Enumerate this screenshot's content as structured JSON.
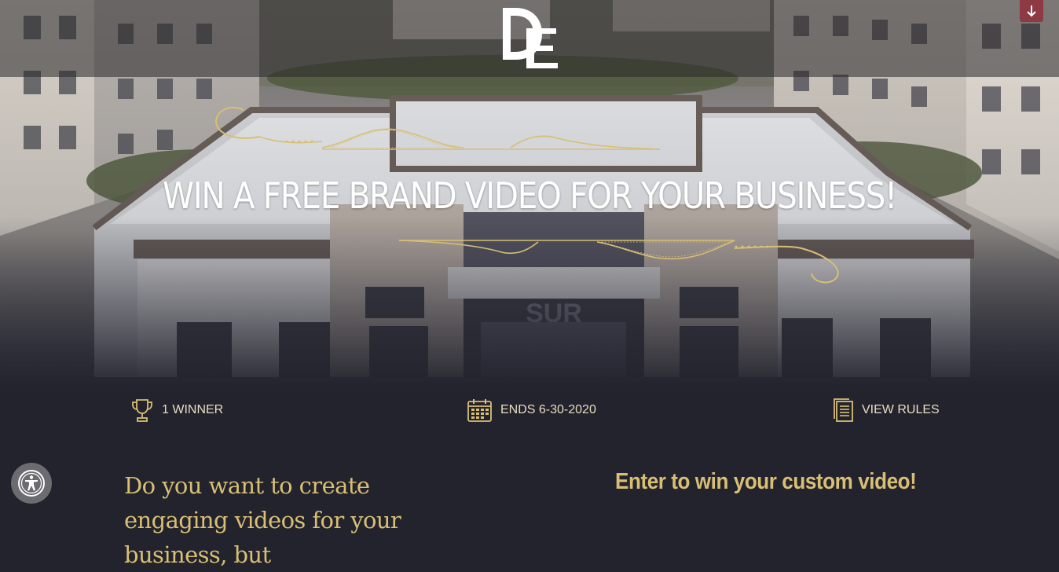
{
  "brand": {
    "logo_text": "DE"
  },
  "header": {
    "scroll_icon": "arrow-down-icon"
  },
  "hero": {
    "headline": "WIN A FREE BRAND VIDEO FOR YOUR BUSINESS!"
  },
  "stats": {
    "winners": {
      "icon": "trophy-icon",
      "label": "1 WINNER"
    },
    "ends": {
      "icon": "calendar-icon",
      "label": "ENDS 6-30-2020"
    },
    "rules": {
      "icon": "document-icon",
      "label": "VIEW RULES"
    }
  },
  "content": {
    "question": "Do you want to create engaging videos for your business, but",
    "entry_title": "Enter to win your custom video!"
  },
  "accessibility": {
    "icon": "accessibility-icon"
  },
  "colors": {
    "gold": "#d8bf74",
    "background": "#23232e",
    "accent": "#8e3a44"
  }
}
